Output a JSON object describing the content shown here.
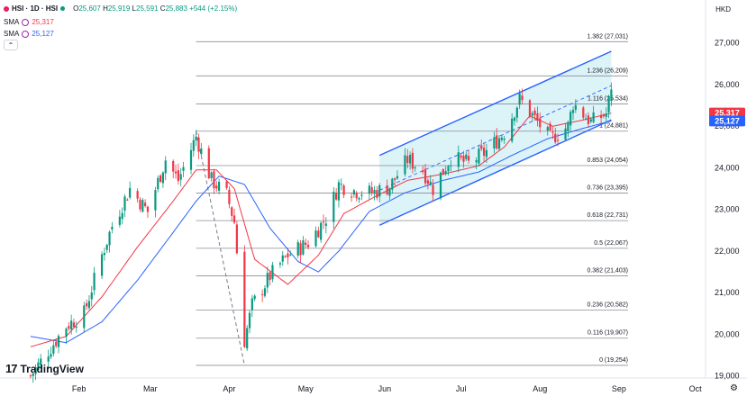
{
  "header": {
    "symbol": "HSI · 1D · HSI",
    "ohlc": [
      {
        "k": "O",
        "v": "25,607"
      },
      {
        "k": "H",
        "v": "25,919"
      },
      {
        "k": "L",
        "v": "25,591"
      },
      {
        "k": "C",
        "v": "25,883"
      }
    ],
    "change": "+544 (+2.15%)",
    "indicators": [
      {
        "name": "SMA",
        "value": "25,317",
        "color": "#f23645"
      },
      {
        "name": "SMA",
        "value": "25,127",
        "color": "#2962ff"
      }
    ],
    "collapse_icon": "chevron-up-icon"
  },
  "currency": "HKD",
  "brand": "TradingView",
  "colors": {
    "up": "#089981",
    "down": "#f23645",
    "sma_fast": "#f23645",
    "sma_slow": "#2962ff",
    "channel_fill": "#d6f1f7",
    "channel_line": "#2962ff",
    "fib_line": "#8a8d96"
  },
  "chart_data": {
    "type": "candlestick",
    "symbol": "HSI",
    "interval": "1D",
    "ylim": [
      18950,
      27600
    ],
    "y_ticks": [
      "19,000",
      "20,000",
      "21,000",
      "22,000",
      "23,000",
      "24,000",
      "25,000",
      "26,000",
      "27,000"
    ],
    "x_ticks": [
      "Feb",
      "Mar",
      "Apr",
      "May",
      "Jun",
      "Jul",
      "Aug",
      "Sep",
      "Oct"
    ],
    "price_labels": [
      {
        "value": 25317,
        "label": "25,317",
        "color": "#f23645"
      },
      {
        "value": 25127,
        "label": "25,127",
        "color": "#2962ff"
      }
    ],
    "fibonacci": [
      {
        "ratio": "1.382",
        "value": 27031,
        "label": "1.382 (27,031)"
      },
      {
        "ratio": "1.236",
        "value": 26209,
        "label": "1.236 (26,209)"
      },
      {
        "ratio": "1.116",
        "value": 25534,
        "label": "1.116 (25,534)"
      },
      {
        "ratio": "1",
        "value": 24881,
        "label": "1 (24,881)"
      },
      {
        "ratio": "0.853",
        "value": 24054,
        "label": "0.853 (24,054)"
      },
      {
        "ratio": "0.736",
        "value": 23395,
        "label": "0.736 (23,395)"
      },
      {
        "ratio": "0.618",
        "value": 22731,
        "label": "0.618 (22,731)"
      },
      {
        "ratio": "0.5",
        "value": 22067,
        "label": "0.5 (22,067)"
      },
      {
        "ratio": "0.382",
        "value": 21403,
        "label": "0.382 (21,403)"
      },
      {
        "ratio": "0.236",
        "value": 20582,
        "label": "0.236 (20,582)"
      },
      {
        "ratio": "0.116",
        "value": 19907,
        "label": "0.116 (19,907)"
      },
      {
        "ratio": "0",
        "value": 19254,
        "label": "0 (19,254)"
      }
    ],
    "channel": {
      "start_date": "2025-05-30",
      "end_date": "2025-08-29",
      "upper": [
        24300,
        26800
      ],
      "lower": [
        22620,
        25150
      ],
      "mid": [
        23460,
        25975
      ]
    },
    "projection": {
      "from_date": "2025-03-19",
      "from_value": 24881,
      "to_date": "2025-04-07",
      "to_value": 19254
    },
    "close_points": [
      [
        "2025-01-13",
        19000
      ],
      [
        "2025-01-20",
        19600
      ],
      [
        "2025-01-27",
        20200
      ],
      [
        "2025-02-03",
        20500
      ],
      [
        "2025-02-10",
        21900
      ],
      [
        "2025-02-14",
        22600
      ],
      [
        "2025-02-21",
        23500
      ],
      [
        "2025-02-28",
        22950
      ],
      [
        "2025-03-07",
        24200
      ],
      [
        "2025-03-12",
        23700
      ],
      [
        "2025-03-19",
        24750
      ],
      [
        "2025-03-25",
        23700
      ],
      [
        "2025-03-31",
        23350
      ],
      [
        "2025-04-03",
        22700
      ],
      [
        "2025-04-07",
        19850
      ],
      [
        "2025-04-10",
        20700
      ],
      [
        "2025-04-17",
        21400
      ],
      [
        "2025-04-24",
        21900
      ],
      [
        "2025-05-02",
        22200
      ],
      [
        "2025-05-09",
        22800
      ],
      [
        "2025-05-14",
        23600
      ],
      [
        "2025-05-20",
        23450
      ],
      [
        "2025-05-27",
        23400
      ],
      [
        "2025-06-03",
        23550
      ],
      [
        "2025-06-10",
        24200
      ],
      [
        "2025-06-16",
        23950
      ],
      [
        "2025-06-20",
        23500
      ],
      [
        "2025-06-27",
        24250
      ],
      [
        "2025-07-04",
        24100
      ],
      [
        "2025-07-11",
        24400
      ],
      [
        "2025-07-18",
        24850
      ],
      [
        "2025-07-24",
        25650
      ],
      [
        "2025-07-31",
        25100
      ],
      [
        "2025-08-05",
        24700
      ],
      [
        "2025-08-12",
        25000
      ],
      [
        "2025-08-14",
        25550
      ],
      [
        "2025-08-21",
        25100
      ],
      [
        "2025-08-27",
        25300
      ],
      [
        "2025-08-29",
        25883
      ]
    ],
    "sma_fast_points": [
      [
        "2025-01-13",
        19700
      ],
      [
        "2025-01-27",
        19950
      ],
      [
        "2025-02-10",
        20900
      ],
      [
        "2025-02-24",
        22100
      ],
      [
        "2025-03-10",
        23200
      ],
      [
        "2025-03-19",
        23950
      ],
      [
        "2025-03-27",
        23950
      ],
      [
        "2025-04-03",
        23500
      ],
      [
        "2025-04-11",
        21800
      ],
      [
        "2025-04-24",
        21200
      ],
      [
        "2025-05-06",
        21900
      ],
      [
        "2025-05-16",
        22900
      ],
      [
        "2025-05-28",
        23300
      ],
      [
        "2025-06-10",
        23700
      ],
      [
        "2025-06-24",
        23850
      ],
      [
        "2025-07-08",
        24050
      ],
      [
        "2025-07-18",
        24500
      ],
      [
        "2025-07-28",
        25250
      ],
      [
        "2025-08-06",
        25000
      ],
      [
        "2025-08-18",
        25150
      ],
      [
        "2025-08-29",
        25317
      ]
    ],
    "sma_slow_points": [
      [
        "2025-01-13",
        19950
      ],
      [
        "2025-01-27",
        19800
      ],
      [
        "2025-02-10",
        20300
      ],
      [
        "2025-02-24",
        21300
      ],
      [
        "2025-03-10",
        22450
      ],
      [
        "2025-03-19",
        23200
      ],
      [
        "2025-03-28",
        23800
      ],
      [
        "2025-04-07",
        23600
      ],
      [
        "2025-04-17",
        22550
      ],
      [
        "2025-04-28",
        21750
      ],
      [
        "2025-05-06",
        21500
      ],
      [
        "2025-05-14",
        22000
      ],
      [
        "2025-05-26",
        22950
      ],
      [
        "2025-06-09",
        23400
      ],
      [
        "2025-06-24",
        23700
      ],
      [
        "2025-07-08",
        23900
      ],
      [
        "2025-07-21",
        24300
      ],
      [
        "2025-08-04",
        24700
      ],
      [
        "2025-08-18",
        24950
      ],
      [
        "2025-08-29",
        25127
      ]
    ]
  }
}
